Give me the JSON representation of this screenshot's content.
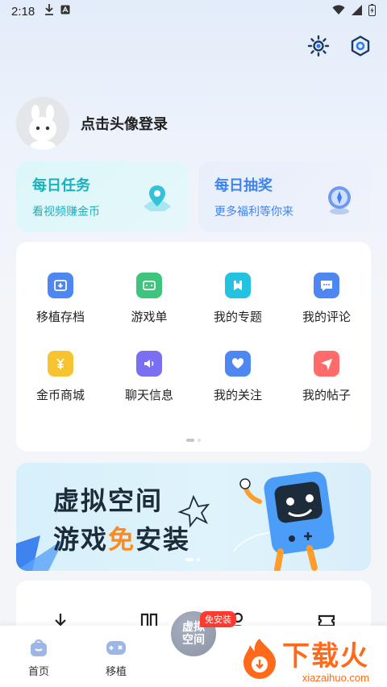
{
  "status_bar": {
    "time": "2:18"
  },
  "profile": {
    "login_prompt": "点击头像登录"
  },
  "quick_cards": [
    {
      "title": "每日任务",
      "subtitle": "看视频赚金币",
      "icon": "map-pin-icon",
      "color": "#1bb1bc"
    },
    {
      "title": "每日抽奖",
      "subtitle": "更多福利等你来",
      "icon": "compass-icon",
      "color": "#3f83f1"
    }
  ],
  "grid": {
    "items": [
      {
        "label": "移植存档",
        "icon": "archive-icon",
        "color": "#4f87f2"
      },
      {
        "label": "游戏单",
        "icon": "game-list-icon",
        "color": "#3fc47e"
      },
      {
        "label": "我的专题",
        "icon": "topic-icon",
        "color": "#22c2e0"
      },
      {
        "label": "我的评论",
        "icon": "comment-icon",
        "color": "#4f87f2"
      },
      {
        "label": "金币商城",
        "icon": "coin-store-icon",
        "color": "#f7c331"
      },
      {
        "label": "聊天信息",
        "icon": "chat-icon",
        "color": "#7a6ff0"
      },
      {
        "label": "我的关注",
        "icon": "heart-icon",
        "color": "#4f87f2"
      },
      {
        "label": "我的帖子",
        "icon": "post-icon",
        "color": "#ff6b6b"
      }
    ]
  },
  "banner": {
    "line1": "虚拟空间",
    "line2_prefix": "游戏",
    "line2_highlight": "免",
    "line2_suffix": "安装"
  },
  "tabbar": {
    "home_label": "首页",
    "port_label": "移植",
    "center_label": "虚拟空间",
    "center_badge": "免安装"
  },
  "watermark": {
    "title": "下载火",
    "subtitle": "xiazaihuo.com"
  }
}
